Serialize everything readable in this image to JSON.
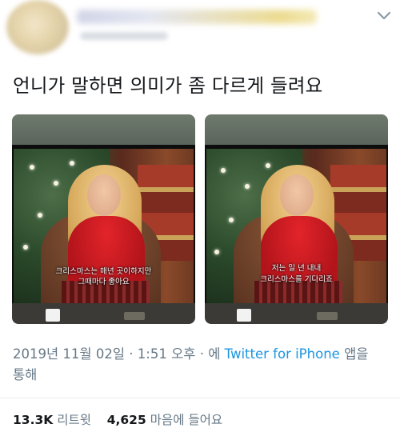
{
  "author": {
    "avatar_icon": "avatar",
    "name_redacted": true
  },
  "menu_icon": "chevron-down-icon",
  "tweet": {
    "text": "언니가 말하면 의미가 좀 다르게 들려요"
  },
  "media": [
    {
      "subtitle_line1": "크리스마스는 매년 곳이하지만",
      "subtitle_line2": "그때마다 좋아요"
    },
    {
      "subtitle_line1": "저는 일 년 내내",
      "subtitle_line2": "크리스마스를 기다리죠"
    }
  ],
  "meta": {
    "date": "2019년 11월 02일",
    "dot1": "·",
    "time": "1:51 오후",
    "dot2": "·",
    "via_prefix": "에",
    "source": "Twitter for iPhone",
    "via_suffix_part1": "앱을",
    "via_suffix_part2": "통해"
  },
  "stats": {
    "retweets_count": "13.3K",
    "retweets_label": "리트윗",
    "likes_count": "4,625",
    "likes_label": "마음에 들어요"
  },
  "colors": {
    "text": "#14171a",
    "muted": "#657786",
    "link": "#1b95e0",
    "divider": "#e6ecf0"
  }
}
